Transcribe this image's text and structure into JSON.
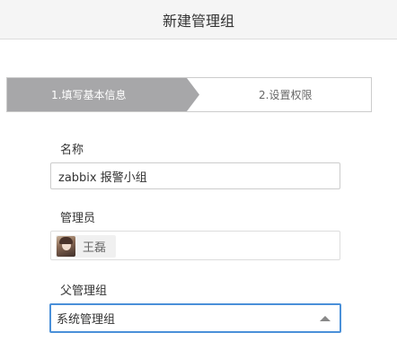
{
  "header": {
    "title": "新建管理组"
  },
  "stepper": {
    "steps": [
      {
        "label": "1.填写基本信息",
        "active": true
      },
      {
        "label": "2.设置权限",
        "active": false
      }
    ],
    "active_color": "#a7a7a9"
  },
  "form": {
    "name": {
      "label": "名称",
      "value": "zabbix 报警小组"
    },
    "admins": {
      "label": "管理员",
      "users": [
        {
          "name": "王磊",
          "avatar": "user-avatar-icon"
        }
      ]
    },
    "parent_group": {
      "label": "父管理组",
      "selected": "系统管理组",
      "focus_color": "#4a90d9"
    }
  }
}
